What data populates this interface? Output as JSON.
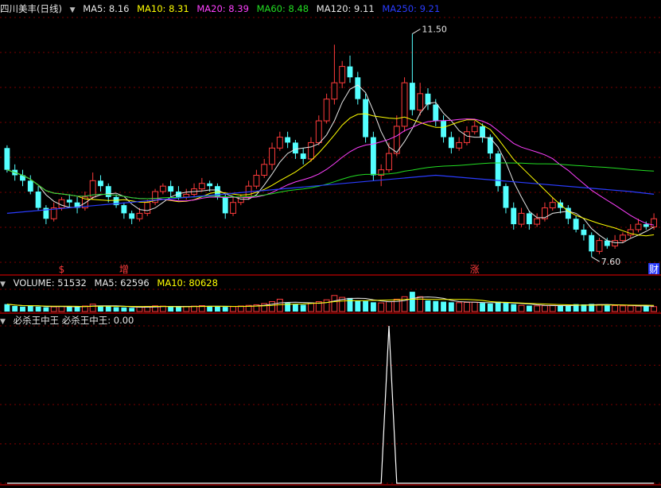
{
  "main_header": {
    "stock_name": "四川美丰(日线)",
    "ma_items": [
      {
        "label": "MA5: 8.16",
        "color": "#e6e6e6"
      },
      {
        "label": "MA10: 8.31",
        "color": "#ffff00"
      },
      {
        "label": "MA20: 8.39",
        "color": "#ff40ff"
      },
      {
        "label": "MA60: 8.48",
        "color": "#22dd22"
      },
      {
        "label": "MA120: 9.11",
        "color": "#e6e6e6"
      },
      {
        "label": "MA250: 9.21",
        "color": "#2a3cff"
      }
    ]
  },
  "volume_header": {
    "items": [
      {
        "label": "VOLUME: 51532",
        "color": "#e6e6e6"
      },
      {
        "label": "MA5: 62596",
        "color": "#e6e6e6"
      },
      {
        "label": "MA10: 80628",
        "color": "#ffff00"
      }
    ]
  },
  "indicator_header": {
    "items": [
      {
        "label": "必杀王中王  必杀王中王: 0.00",
        "color": "#e6e6e6"
      }
    ]
  },
  "colors": {
    "up": "#ff3b3b",
    "down": "#54ffff",
    "grid": "#7a0000",
    "divider": "#a00000",
    "ma5": "#e6e6e6",
    "ma10": "#ffff00",
    "ma20": "#ff40ff",
    "ma60": "#22dd22",
    "ma250": "#2a3cff",
    "vol_ma": "#ffff00"
  },
  "chart_data": [
    {
      "type": "candlestick",
      "panel": "price",
      "price_range": [
        7.3,
        11.8
      ],
      "candles": [
        [
          9.4,
          9.0,
          9.45,
          8.95
        ],
        [
          9.0,
          8.9,
          9.1,
          8.8
        ],
        [
          8.9,
          8.8,
          9.0,
          8.7
        ],
        [
          8.8,
          8.6,
          8.9,
          8.55
        ],
        [
          8.6,
          8.3,
          8.7,
          8.25
        ],
        [
          8.3,
          8.1,
          8.35,
          8.0
        ],
        [
          8.1,
          8.3,
          8.4,
          8.05
        ],
        [
          8.3,
          8.45,
          8.5,
          8.25
        ],
        [
          8.45,
          8.4,
          8.55,
          8.3
        ],
        [
          8.4,
          8.3,
          8.5,
          8.2
        ],
        [
          8.3,
          8.5,
          8.6,
          8.25
        ],
        [
          8.5,
          8.8,
          8.95,
          8.45
        ],
        [
          8.8,
          8.7,
          8.9,
          8.6
        ],
        [
          8.7,
          8.5,
          8.75,
          8.4
        ],
        [
          8.5,
          8.35,
          8.55,
          8.3
        ],
        [
          8.35,
          8.2,
          8.4,
          8.1
        ],
        [
          8.2,
          8.1,
          8.25,
          8.0
        ],
        [
          8.1,
          8.2,
          8.3,
          8.05
        ],
        [
          8.2,
          8.4,
          8.45,
          8.15
        ],
        [
          8.4,
          8.6,
          8.65,
          8.35
        ],
        [
          8.6,
          8.7,
          8.75,
          8.55
        ],
        [
          8.7,
          8.6,
          8.8,
          8.5
        ],
        [
          8.6,
          8.5,
          8.7,
          8.45
        ],
        [
          8.5,
          8.55,
          8.65,
          8.45
        ],
        [
          8.55,
          8.65,
          8.75,
          8.5
        ],
        [
          8.65,
          8.75,
          8.85,
          8.6
        ],
        [
          8.75,
          8.7,
          8.8,
          8.6
        ],
        [
          8.7,
          8.5,
          8.75,
          8.45
        ],
        [
          8.5,
          8.2,
          8.55,
          8.1
        ],
        [
          8.2,
          8.4,
          8.5,
          8.15
        ],
        [
          8.4,
          8.5,
          8.55,
          8.35
        ],
        [
          8.5,
          8.7,
          8.8,
          8.45
        ],
        [
          8.7,
          8.9,
          9.0,
          8.65
        ],
        [
          8.9,
          9.1,
          9.2,
          8.85
        ],
        [
          9.1,
          9.4,
          9.5,
          9.0
        ],
        [
          9.4,
          9.6,
          9.7,
          9.35
        ],
        [
          9.6,
          9.5,
          9.7,
          9.4
        ],
        [
          9.5,
          9.3,
          9.55,
          9.2
        ],
        [
          9.3,
          9.2,
          9.4,
          9.1
        ],
        [
          9.2,
          9.5,
          9.6,
          9.15
        ],
        [
          9.5,
          9.9,
          10.0,
          9.45
        ],
        [
          9.9,
          10.3,
          10.4,
          9.85
        ],
        [
          10.3,
          10.6,
          11.3,
          10.2
        ],
        [
          10.6,
          10.9,
          11.0,
          10.5
        ],
        [
          10.9,
          10.7,
          11.1,
          10.6
        ],
        [
          10.7,
          10.3,
          10.8,
          10.2
        ],
        [
          10.3,
          9.6,
          10.4,
          9.5
        ],
        [
          9.6,
          8.9,
          9.7,
          8.8
        ],
        [
          8.9,
          9.0,
          9.1,
          8.7
        ],
        [
          9.0,
          9.3,
          9.5,
          8.95
        ],
        [
          9.3,
          9.8,
          10.0,
          9.25
        ],
        [
          9.8,
          10.6,
          10.7,
          9.7
        ],
        [
          10.6,
          10.1,
          11.5,
          10.0
        ],
        [
          10.1,
          10.4,
          10.6,
          10.0
        ],
        [
          10.4,
          10.2,
          10.5,
          10.1
        ],
        [
          10.2,
          9.9,
          10.3,
          9.8
        ],
        [
          9.9,
          9.6,
          10.0,
          9.5
        ],
        [
          9.6,
          9.4,
          9.7,
          9.3
        ],
        [
          9.4,
          9.5,
          9.6,
          9.35
        ],
        [
          9.5,
          9.7,
          9.8,
          9.45
        ],
        [
          9.7,
          9.8,
          9.9,
          9.65
        ],
        [
          9.8,
          9.6,
          9.85,
          9.5
        ],
        [
          9.6,
          9.3,
          9.65,
          9.2
        ],
        [
          9.3,
          8.7,
          9.35,
          8.6
        ],
        [
          8.7,
          8.3,
          8.75,
          8.2
        ],
        [
          8.3,
          8.0,
          8.4,
          7.9
        ],
        [
          8.0,
          8.2,
          8.3,
          7.95
        ],
        [
          8.2,
          8.0,
          8.25,
          7.9
        ],
        [
          8.0,
          8.1,
          8.2,
          7.95
        ],
        [
          8.1,
          8.3,
          8.4,
          8.05
        ],
        [
          8.3,
          8.4,
          8.5,
          8.25
        ],
        [
          8.4,
          8.3,
          8.45,
          8.2
        ],
        [
          8.3,
          8.1,
          8.35,
          8.0
        ],
        [
          8.1,
          7.9,
          8.15,
          7.85
        ],
        [
          7.9,
          7.8,
          8.0,
          7.7
        ],
        [
          7.8,
          7.5,
          7.85,
          7.4
        ],
        [
          7.5,
          7.7,
          7.75,
          7.45
        ],
        [
          7.7,
          7.6,
          7.75,
          7.55
        ],
        [
          7.6,
          7.7,
          7.8,
          7.55
        ],
        [
          7.7,
          7.8,
          7.85,
          7.65
        ],
        [
          7.8,
          7.9,
          8.0,
          7.75
        ],
        [
          7.9,
          8.0,
          8.1,
          7.85
        ],
        [
          8.0,
          7.95,
          8.05,
          7.9
        ],
        [
          7.95,
          8.1,
          8.2,
          7.9
        ]
      ],
      "ma250_endpoints": [
        [
          0,
          8.2
        ],
        [
          55,
          8.9
        ],
        [
          80,
          8.6
        ],
        [
          83,
          8.55
        ]
      ],
      "markers": [
        {
          "text": "$",
          "candle": 7,
          "color": "#ff3b3b"
        },
        {
          "text": "增",
          "candle": 15,
          "color": "#ff3b3b"
        },
        {
          "text": "涨",
          "candle": 60,
          "color": "#ff3b3b"
        },
        {
          "text": "财",
          "candle": 88,
          "color": "#ffffff",
          "bg": "#2a3cff"
        }
      ],
      "annotations": [
        {
          "text": "11.50",
          "candle": 52,
          "price": 11.5
        },
        {
          "text": "7.60",
          "candle": 75,
          "price": 7.4
        }
      ]
    },
    {
      "type": "bar",
      "panel": "volume",
      "values": [
        60,
        45,
        40,
        45,
        40,
        35,
        38,
        42,
        40,
        38,
        45,
        60,
        48,
        42,
        36,
        34,
        30,
        36,
        42,
        46,
        44,
        40,
        38,
        42,
        44,
        48,
        42,
        40,
        38,
        40,
        45,
        50,
        55,
        65,
        80,
        100,
        70,
        60,
        55,
        70,
        80,
        95,
        130,
        115,
        110,
        90,
        85,
        75,
        70,
        80,
        100,
        120,
        160,
        120,
        90,
        85,
        80,
        75,
        72,
        74,
        76,
        70,
        65,
        80,
        70,
        60,
        50,
        48,
        46,
        48,
        50,
        48,
        46,
        60,
        58,
        62,
        56,
        50,
        48,
        46,
        46,
        44,
        42,
        40
      ],
      "range": [
        0,
        180
      ]
    },
    {
      "type": "line",
      "panel": "indicator",
      "spike_candle": 49,
      "range": [
        0,
        1
      ]
    }
  ]
}
